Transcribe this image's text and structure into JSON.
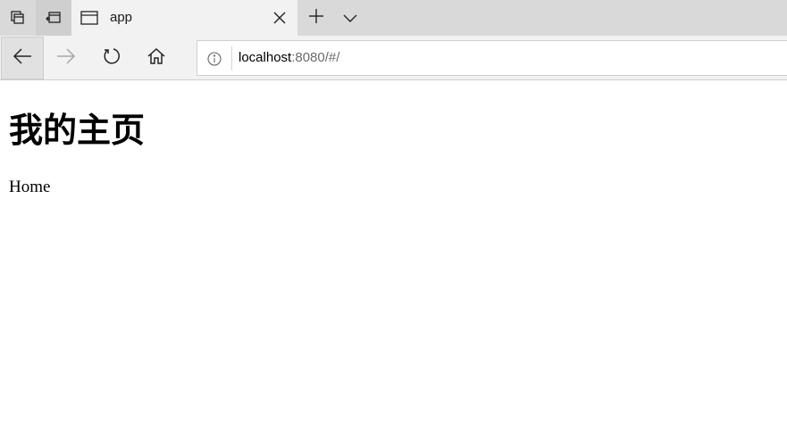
{
  "browser": {
    "tabs": [
      {
        "title": "app",
        "active": true
      }
    ],
    "address_bar": {
      "url_host": "localhost",
      "url_rest": ":8080/#/"
    },
    "icons": {
      "tab_actions": "set-aside-tabs-icon",
      "tabs_aside": "tabs-aside-icon",
      "favicon": "window-page-icon",
      "close": "close-icon",
      "new_tab": "plus-icon",
      "tab_list": "chevron-down-icon",
      "back": "back-arrow-icon",
      "forward": "forward-arrow-icon",
      "refresh": "refresh-icon",
      "home": "home-icon",
      "site_info": "info-icon"
    }
  },
  "page": {
    "heading": "我的主页",
    "text": "Home"
  },
  "colors": {
    "tab_strip": "#d9d9d9",
    "toolbar": "#f2f2f2",
    "forward_disabled": "#a6a6a6"
  }
}
